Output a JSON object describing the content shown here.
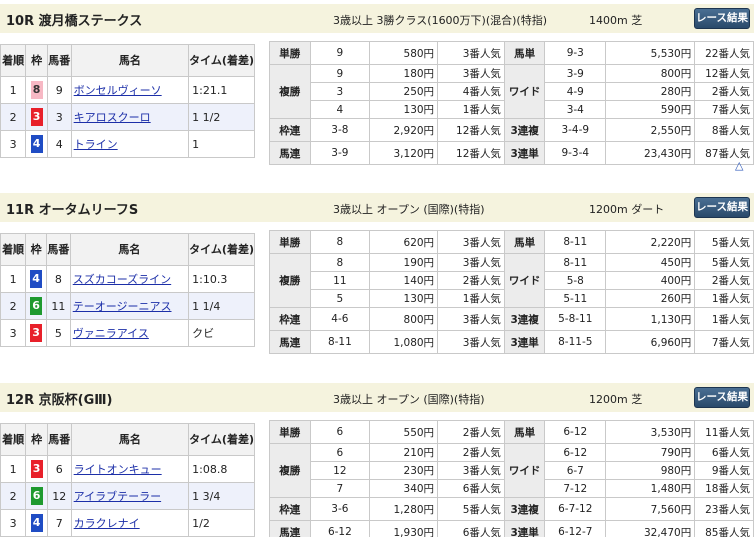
{
  "races": [
    {
      "name": "10R 渡月橋ステークス",
      "cond": "3歳以上 3勝クラス(1600万下)(混合)(特指)",
      "dist": "1400m 芝",
      "button": "レース結果",
      "headers": {
        "rank": "着順",
        "waku": "枠",
        "uma": "馬番",
        "horse": "馬名",
        "time": "タイム(着差)"
      },
      "results": [
        {
          "rank": "1",
          "waku": "8",
          "uma": "9",
          "horse": "ボンセルヴィーソ",
          "time": "1:21.1"
        },
        {
          "rank": "2",
          "waku": "3",
          "uma": "3",
          "horse": "キアロスクーロ",
          "time": "1 1/2"
        },
        {
          "rank": "3",
          "waku": "4",
          "uma": "4",
          "horse": "トライン",
          "time": "1"
        }
      ],
      "pay": {
        "tansho": {
          "label": "単勝",
          "num": "9",
          "yen": "580円",
          "pop": "3番人気"
        },
        "fukusho": {
          "label": "複勝",
          "items": [
            {
              "num": "9",
              "yen": "180円",
              "pop": "3番人気"
            },
            {
              "num": "3",
              "yen": "250円",
              "pop": "4番人気"
            },
            {
              "num": "4",
              "yen": "130円",
              "pop": "1番人気"
            }
          ]
        },
        "wakuren": {
          "label": "枠連",
          "num": "3-8",
          "yen": "2,920円",
          "pop": "12番人気"
        },
        "umaren": {
          "label": "馬連",
          "num": "3-9",
          "yen": "3,120円",
          "pop": "12番人気"
        },
        "umatan": {
          "label": "馬単",
          "num": "9-3",
          "yen": "5,530円",
          "pop": "22番人気"
        },
        "wide": {
          "label": "ワイド",
          "items": [
            {
              "num": "3-9",
              "yen": "800円",
              "pop": "12番人気"
            },
            {
              "num": "4-9",
              "yen": "280円",
              "pop": "2番人気"
            },
            {
              "num": "3-4",
              "yen": "590円",
              "pop": "7番人気"
            }
          ]
        },
        "sanrenpuku": {
          "label": "3連複",
          "num": "3-4-9",
          "yen": "2,550円",
          "pop": "8番人気"
        },
        "sanrentan": {
          "label": "3連単",
          "num": "9-3-4",
          "yen": "23,430円",
          "pop": "87番人気"
        }
      }
    },
    {
      "name": "11R オータムリーフS",
      "cond": "3歳以上 オープン (国際)(特指)",
      "dist": "1200m ダート",
      "button": "レース結果",
      "headers": {
        "rank": "着順",
        "waku": "枠",
        "uma": "馬番",
        "horse": "馬名",
        "time": "タイム(着差)"
      },
      "results": [
        {
          "rank": "1",
          "waku": "4",
          "uma": "8",
          "horse": "スズカコーズライン",
          "time": "1:10.3"
        },
        {
          "rank": "2",
          "waku": "6",
          "uma": "11",
          "horse": "テーオージーニアス",
          "time": "1 1/4"
        },
        {
          "rank": "3",
          "waku": "3",
          "uma": "5",
          "horse": "ヴァニラアイス",
          "time": "クビ"
        }
      ],
      "pay": {
        "tansho": {
          "label": "単勝",
          "num": "8",
          "yen": "620円",
          "pop": "3番人気"
        },
        "fukusho": {
          "label": "複勝",
          "items": [
            {
              "num": "8",
              "yen": "190円",
              "pop": "3番人気"
            },
            {
              "num": "11",
              "yen": "140円",
              "pop": "2番人気"
            },
            {
              "num": "5",
              "yen": "130円",
              "pop": "1番人気"
            }
          ]
        },
        "wakuren": {
          "label": "枠連",
          "num": "4-6",
          "yen": "800円",
          "pop": "3番人気"
        },
        "umaren": {
          "label": "馬連",
          "num": "8-11",
          "yen": "1,080円",
          "pop": "3番人気"
        },
        "umatan": {
          "label": "馬単",
          "num": "8-11",
          "yen": "2,220円",
          "pop": "5番人気"
        },
        "wide": {
          "label": "ワイド",
          "items": [
            {
              "num": "8-11",
              "yen": "450円",
              "pop": "5番人気"
            },
            {
              "num": "5-8",
              "yen": "400円",
              "pop": "2番人気"
            },
            {
              "num": "5-11",
              "yen": "260円",
              "pop": "1番人気"
            }
          ]
        },
        "sanrenpuku": {
          "label": "3連複",
          "num": "5-8-11",
          "yen": "1,130円",
          "pop": "1番人気"
        },
        "sanrentan": {
          "label": "3連単",
          "num": "8-11-5",
          "yen": "6,960円",
          "pop": "7番人気"
        }
      }
    },
    {
      "name": "12R 京阪杯(GⅢ)",
      "cond": "3歳以上 オープン (国際)(特指)",
      "dist": "1200m 芝",
      "button": "レース結果",
      "headers": {
        "rank": "着順",
        "waku": "枠",
        "uma": "馬番",
        "horse": "馬名",
        "time": "タイム(着差)"
      },
      "results": [
        {
          "rank": "1",
          "waku": "3",
          "uma": "6",
          "horse": "ライトオンキュー",
          "time": "1:08.8"
        },
        {
          "rank": "2",
          "waku": "6",
          "uma": "12",
          "horse": "アイラブテーラー",
          "time": "1 3/4"
        },
        {
          "rank": "3",
          "waku": "4",
          "uma": "7",
          "horse": "カラクレナイ",
          "time": "1/2"
        }
      ],
      "pay": {
        "tansho": {
          "label": "単勝",
          "num": "6",
          "yen": "550円",
          "pop": "2番人気"
        },
        "fukusho": {
          "label": "複勝",
          "items": [
            {
              "num": "6",
              "yen": "210円",
              "pop": "2番人気"
            },
            {
              "num": "12",
              "yen": "230円",
              "pop": "3番人気"
            },
            {
              "num": "7",
              "yen": "340円",
              "pop": "6番人気"
            }
          ]
        },
        "wakuren": {
          "label": "枠連",
          "num": "3-6",
          "yen": "1,280円",
          "pop": "5番人気"
        },
        "umaren": {
          "label": "馬連",
          "num": "6-12",
          "yen": "1,930円",
          "pop": "6番人気"
        },
        "umatan": {
          "label": "馬単",
          "num": "6-12",
          "yen": "3,530円",
          "pop": "11番人気"
        },
        "wide": {
          "label": "ワイド",
          "items": [
            {
              "num": "6-12",
              "yen": "790円",
              "pop": "6番人気"
            },
            {
              "num": "6-7",
              "yen": "980円",
              "pop": "9番人気"
            },
            {
              "num": "7-12",
              "yen": "1,480円",
              "pop": "18番人気"
            }
          ]
        },
        "sanrenpuku": {
          "label": "3連複",
          "num": "6-7-12",
          "yen": "7,560円",
          "pop": "23番人気"
        },
        "sanrentan": {
          "label": "3連単",
          "num": "6-12-7",
          "yen": "32,470円",
          "pop": "85番人気"
        }
      }
    }
  ],
  "page_top_symbol": "△",
  "waku_colors": {
    "3": {
      "bg": "#e8202a",
      "fg": "#ffffff"
    },
    "4": {
      "bg": "#1f4cc4",
      "fg": "#ffffff"
    },
    "6": {
      "bg": "#1f9a2f",
      "fg": "#ffffff"
    },
    "8": {
      "bg": "#f7b8c4",
      "fg": "#333333"
    }
  }
}
